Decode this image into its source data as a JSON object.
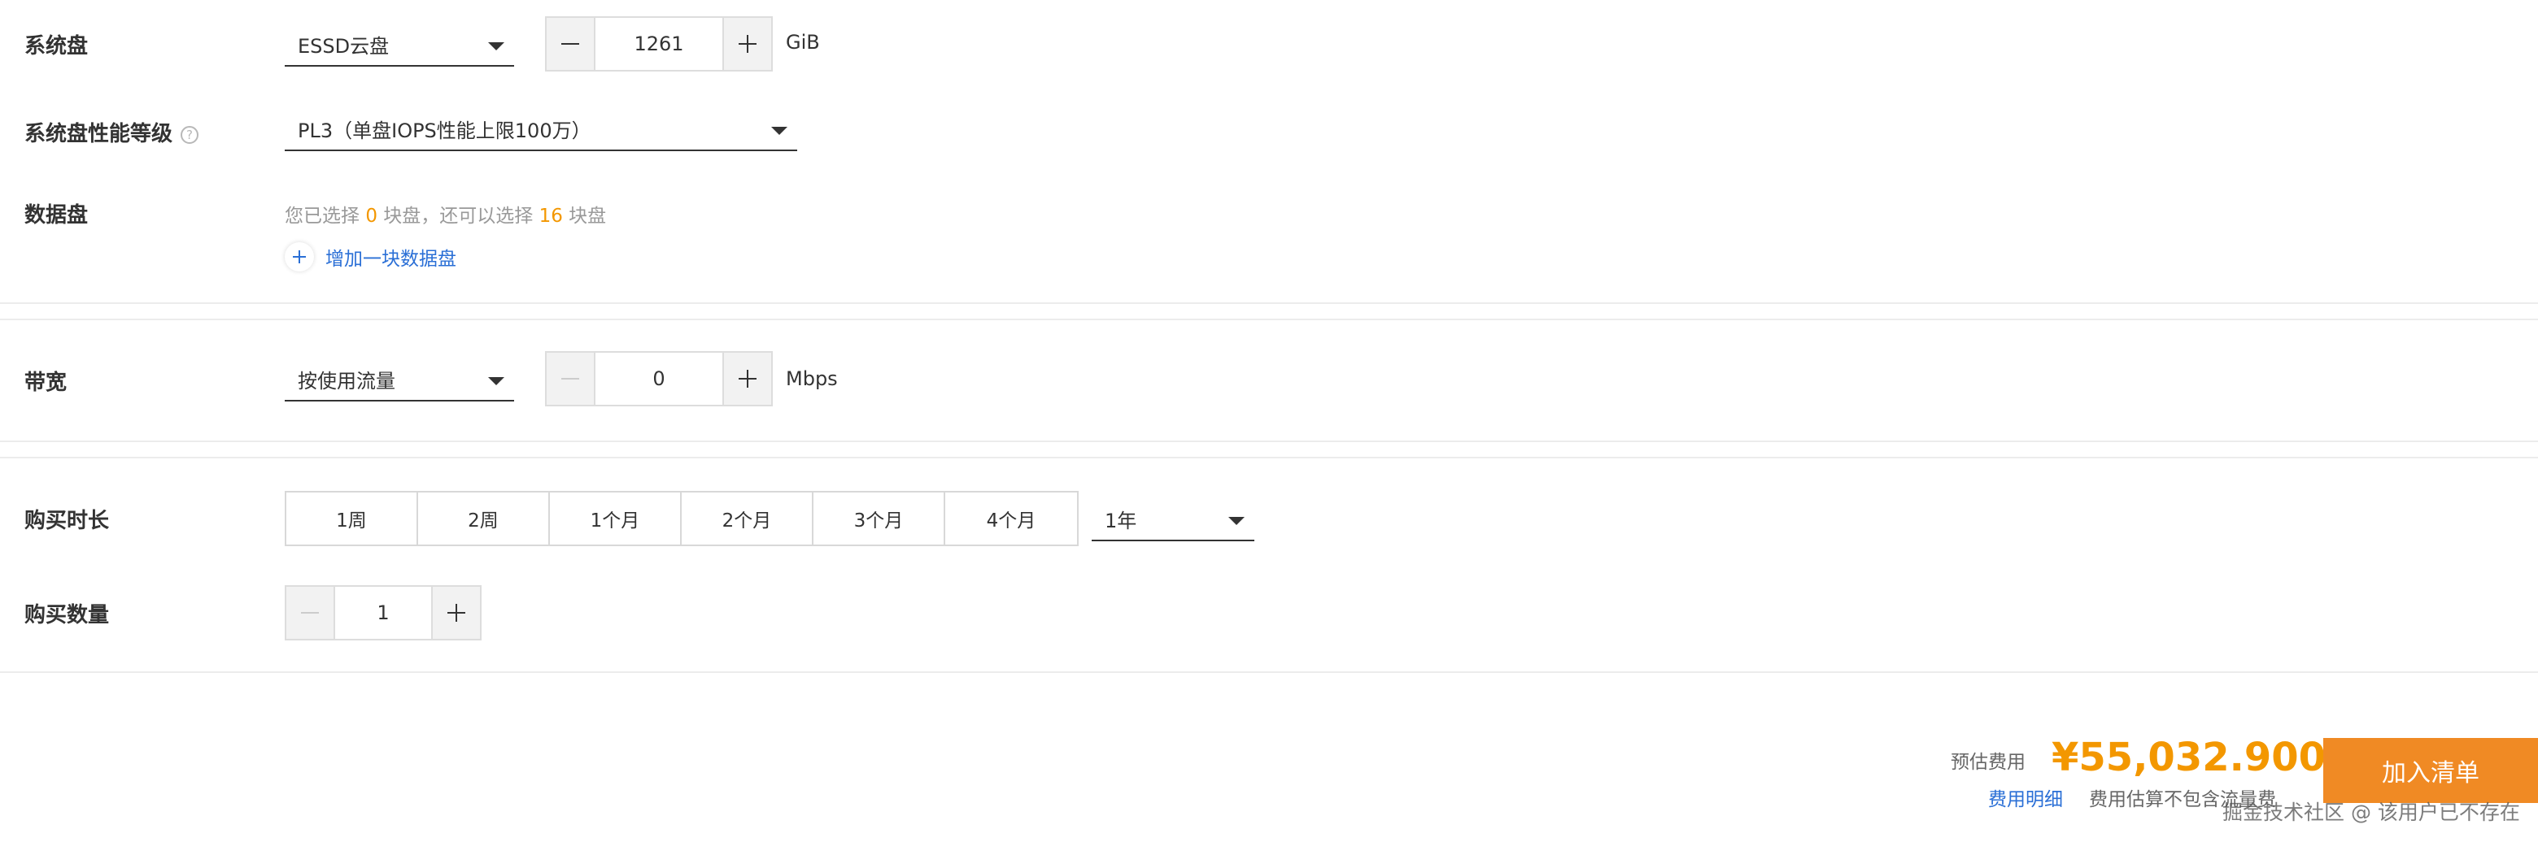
{
  "system_disk": {
    "label": "系统盘",
    "type_value": "ESSD云盘",
    "size_value": "1261",
    "unit": "GiB"
  },
  "perf_level": {
    "label": "系统盘性能等级",
    "help_icon": "?",
    "value": "PL3（单盘IOPS性能上限100万）"
  },
  "data_disk": {
    "label": "数据盘",
    "hint_prefix": "您已选择",
    "selected_count": "0",
    "hint_mid": "块盘，还可以选择",
    "remaining_count": "16",
    "hint_suffix": "块盘",
    "add_label": "增加一块数据盘"
  },
  "bandwidth": {
    "label": "带宽",
    "type_value": "按使用流量",
    "value": "0",
    "unit": "Mbps"
  },
  "duration": {
    "label": "购买时长",
    "options": [
      "1周",
      "2周",
      "1个月",
      "2个月",
      "3个月",
      "4个月"
    ],
    "select_value": "1年"
  },
  "quantity": {
    "label": "购买数量",
    "value": "1"
  },
  "footer": {
    "estimate_label": "预估费用",
    "price": "¥55,032.900",
    "detail_link": "费用明细",
    "note": "费用估算不包含流量费",
    "cta": "加入清单"
  },
  "watermark": "掘金技术社区 @ 该用户已不存在",
  "colors": {
    "accent_orange": "#f39700",
    "link_blue": "#2a6fd6",
    "cta_bg": "#f08a24"
  }
}
